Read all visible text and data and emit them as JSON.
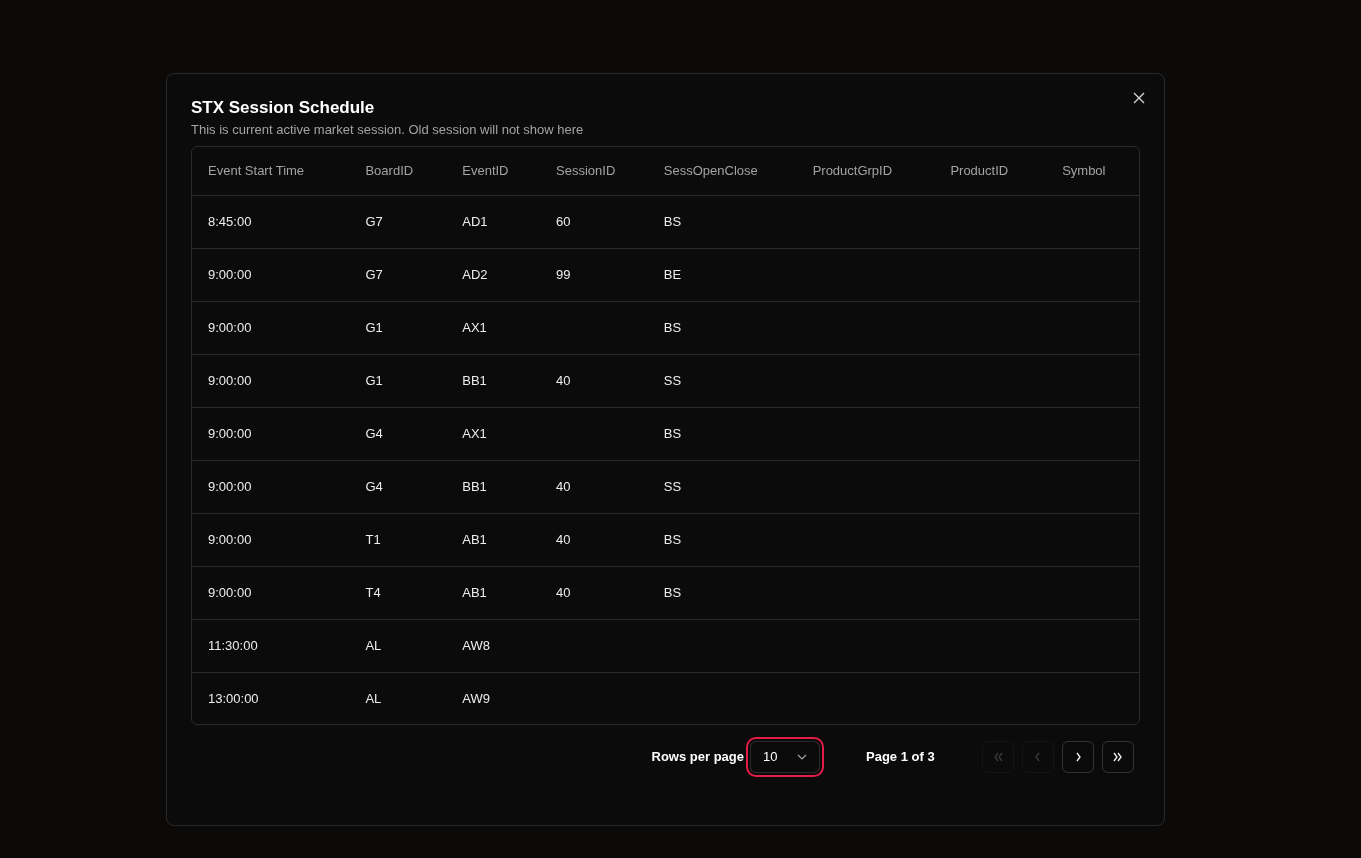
{
  "dialog": {
    "title": "STX Session Schedule",
    "description": "This is current active market session. Old session will not show here"
  },
  "table": {
    "columns": [
      "Event Start Time",
      "BoardID",
      "EventID",
      "SessionID",
      "SessOpenClose",
      "ProductGrpID",
      "ProductID",
      "Symbol"
    ],
    "rows": [
      [
        "8:45:00",
        "G7",
        "AD1",
        "60",
        "BS",
        null,
        null,
        null
      ],
      [
        "9:00:00",
        "G7",
        "AD2",
        "99",
        "BE",
        null,
        null,
        null
      ],
      [
        "9:00:00",
        "G1",
        "AX1",
        null,
        "BS",
        null,
        null,
        null
      ],
      [
        "9:00:00",
        "G1",
        "BB1",
        "40",
        "SS",
        null,
        null,
        null
      ],
      [
        "9:00:00",
        "G4",
        "AX1",
        null,
        "BS",
        null,
        null,
        null
      ],
      [
        "9:00:00",
        "G4",
        "BB1",
        "40",
        "SS",
        null,
        null,
        null
      ],
      [
        "9:00:00",
        "T1",
        "AB1",
        "40",
        "BS",
        null,
        null,
        null
      ],
      [
        "9:00:00",
        "T4",
        "AB1",
        "40",
        "BS",
        null,
        null,
        null
      ],
      [
        "11:30:00",
        "AL",
        "AW8",
        null,
        null,
        null,
        null,
        null
      ],
      [
        "13:00:00",
        "AL",
        "AW9",
        null,
        null,
        null,
        null,
        null
      ]
    ]
  },
  "pagination": {
    "rows_per_page_label": "Rows per page",
    "rows_per_page": {
      "value": "10",
      "focused": true
    },
    "page_label": "Page 1 of 3",
    "buttons": [
      {
        "kind": "first",
        "disabled": true
      },
      {
        "kind": "previous",
        "disabled": true
      },
      {
        "kind": "next",
        "disabled": false
      },
      {
        "kind": "last",
        "disabled": false
      }
    ]
  }
}
